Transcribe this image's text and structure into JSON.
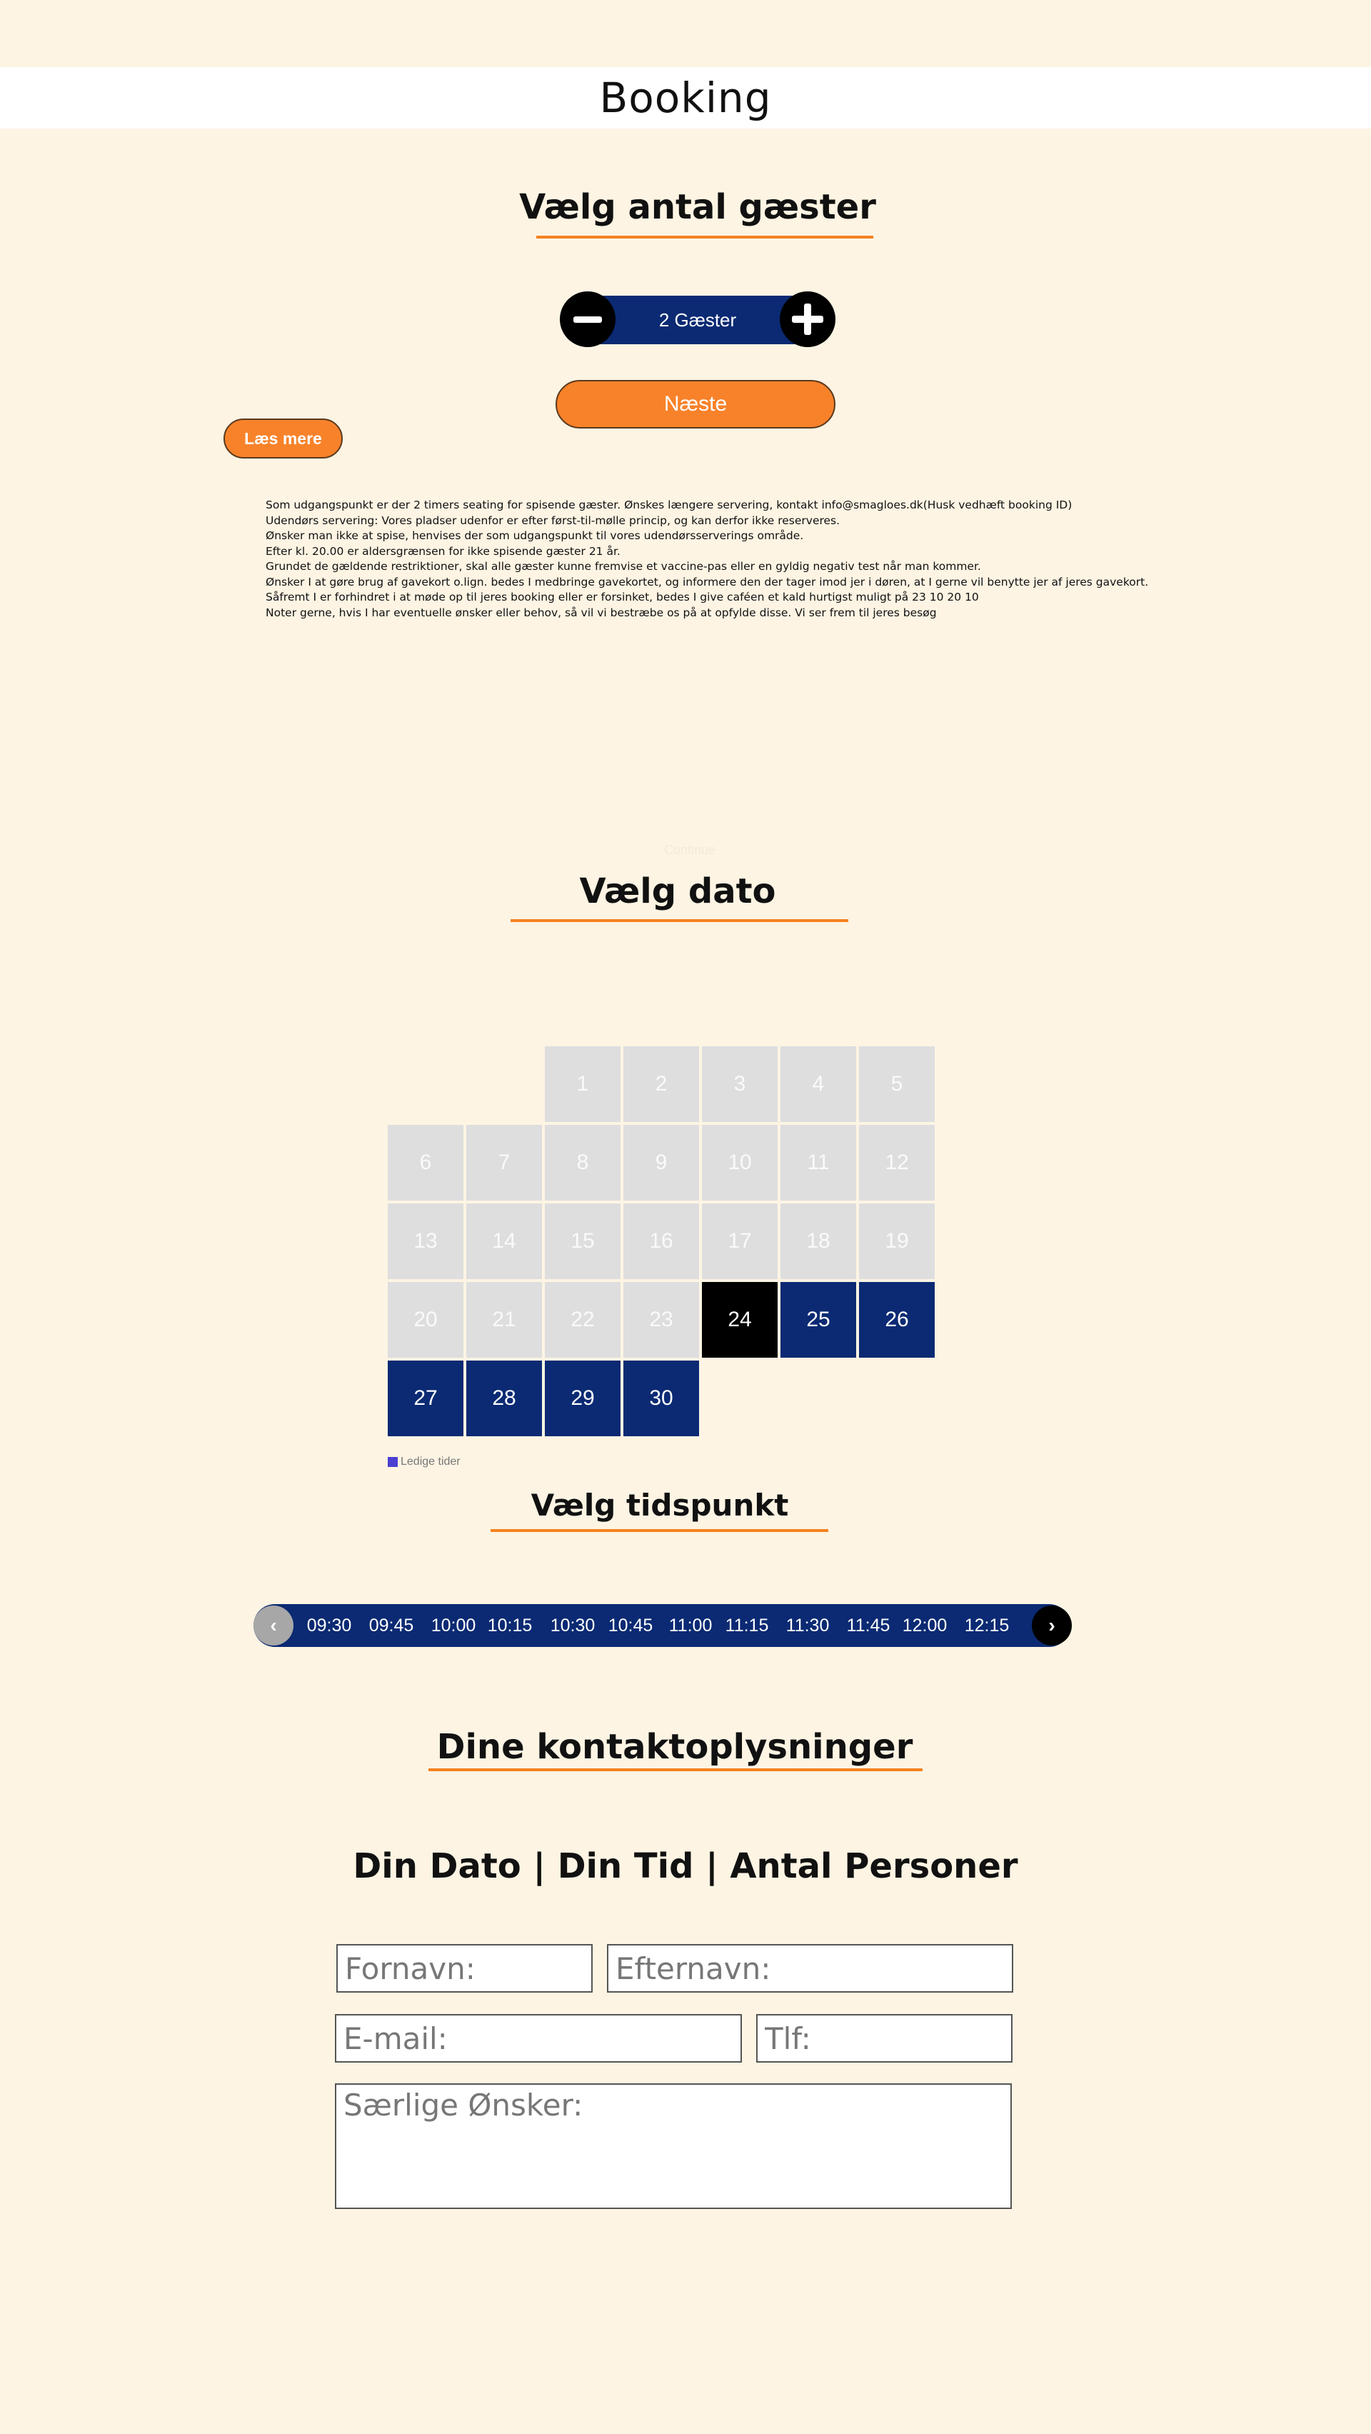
{
  "header": {
    "title": "Booking"
  },
  "guests": {
    "heading": "Vælg antal gæster",
    "count_label": "2 Gæster",
    "next_label": "Næste",
    "read_more_label": "Læs mere"
  },
  "info": {
    "lines": [
      "Som udgangspunkt er der 2 timers seating for spisende gæster. Ønskes længere servering, kontakt info@smagloes.dk(Husk vedhæft booking ID)",
      "Udendørs servering: Vores pladser udenfor er efter først-til-mølle princip, og kan derfor ikke reserveres.",
      "Ønsker man ikke at spise, henvises der som udgangspunkt til vores udendørsserverings område.",
      "Efter kl. 20.00 er aldersgrænsen for ikke spisende gæster 21 år.",
      "Grundet de gældende restriktioner, skal alle gæster kunne fremvise et vaccine-pas eller en gyldig negativ test når man kommer.",
      "Ønsker I at gøre brug af gavekort o.lign. bedes I medbringe gavekortet, og informere den der tager imod jer i døren, at I gerne vil benytte jer af jeres gavekort.",
      "Såfremt I er forhindret i at møde op til jeres booking eller er forsinket, bedes I give caféen et kald hurtigst muligt på 23 10 20 10",
      "Noter gerne, hvis I har eventuelle ønsker eller behov, så vil vi bestræbe os på at opfylde disse. Vi ser frem til jeres besøg"
    ],
    "faint_label": "Continue"
  },
  "date": {
    "heading": "Vælg dato",
    "days": [
      {
        "n": "1",
        "state": "unavailable"
      },
      {
        "n": "2",
        "state": "unavailable"
      },
      {
        "n": "3",
        "state": "unavailable"
      },
      {
        "n": "4",
        "state": "unavailable"
      },
      {
        "n": "5",
        "state": "unavailable"
      },
      {
        "n": "6",
        "state": "unavailable"
      },
      {
        "n": "7",
        "state": "unavailable"
      },
      {
        "n": "8",
        "state": "unavailable"
      },
      {
        "n": "9",
        "state": "unavailable"
      },
      {
        "n": "10",
        "state": "unavailable"
      },
      {
        "n": "11",
        "state": "unavailable"
      },
      {
        "n": "12",
        "state": "unavailable"
      },
      {
        "n": "13",
        "state": "unavailable"
      },
      {
        "n": "14",
        "state": "unavailable"
      },
      {
        "n": "15",
        "state": "unavailable"
      },
      {
        "n": "16",
        "state": "unavailable"
      },
      {
        "n": "17",
        "state": "unavailable"
      },
      {
        "n": "18",
        "state": "unavailable"
      },
      {
        "n": "19",
        "state": "unavailable"
      },
      {
        "n": "20",
        "state": "unavailable"
      },
      {
        "n": "21",
        "state": "unavailable"
      },
      {
        "n": "22",
        "state": "unavailable"
      },
      {
        "n": "23",
        "state": "unavailable"
      },
      {
        "n": "24",
        "state": "selected"
      },
      {
        "n": "25",
        "state": "available"
      },
      {
        "n": "26",
        "state": "available"
      },
      {
        "n": "27",
        "state": "available"
      },
      {
        "n": "28",
        "state": "available"
      },
      {
        "n": "29",
        "state": "available"
      },
      {
        "n": "30",
        "state": "available"
      }
    ],
    "first_weekday_index": 2,
    "legend_label": "Ledige tider",
    "colors": {
      "available": "#0b2a73",
      "selected": "#000000",
      "unavailable": "#dedede",
      "legend": "#4a3fd1"
    }
  },
  "time": {
    "heading": "Vælg tidspunkt",
    "prev_icon": "chevron-left-icon",
    "next_icon": "chevron-right-icon",
    "prev_label": "‹",
    "next_label": "›",
    "slots": [
      "09:30",
      "09:45",
      "10:00",
      "10:15",
      "10:30",
      "10:45",
      "11:00",
      "11:15",
      "11:30",
      "11:45",
      "12:00",
      "12:15"
    ]
  },
  "contact": {
    "heading": "Dine kontaktoplysninger",
    "summary": "Din Dato | Din Tid | Antal Personer",
    "first_name_placeholder": "Fornavn:",
    "last_name_placeholder": "Efternavn:",
    "email_placeholder": "E-mail:",
    "phone_placeholder": "Tlf:",
    "wishes_placeholder": "Særlige Ønsker:"
  },
  "colors": {
    "accent": "#f58220",
    "navy": "#0b2a73",
    "background": "#fdf4e3"
  }
}
